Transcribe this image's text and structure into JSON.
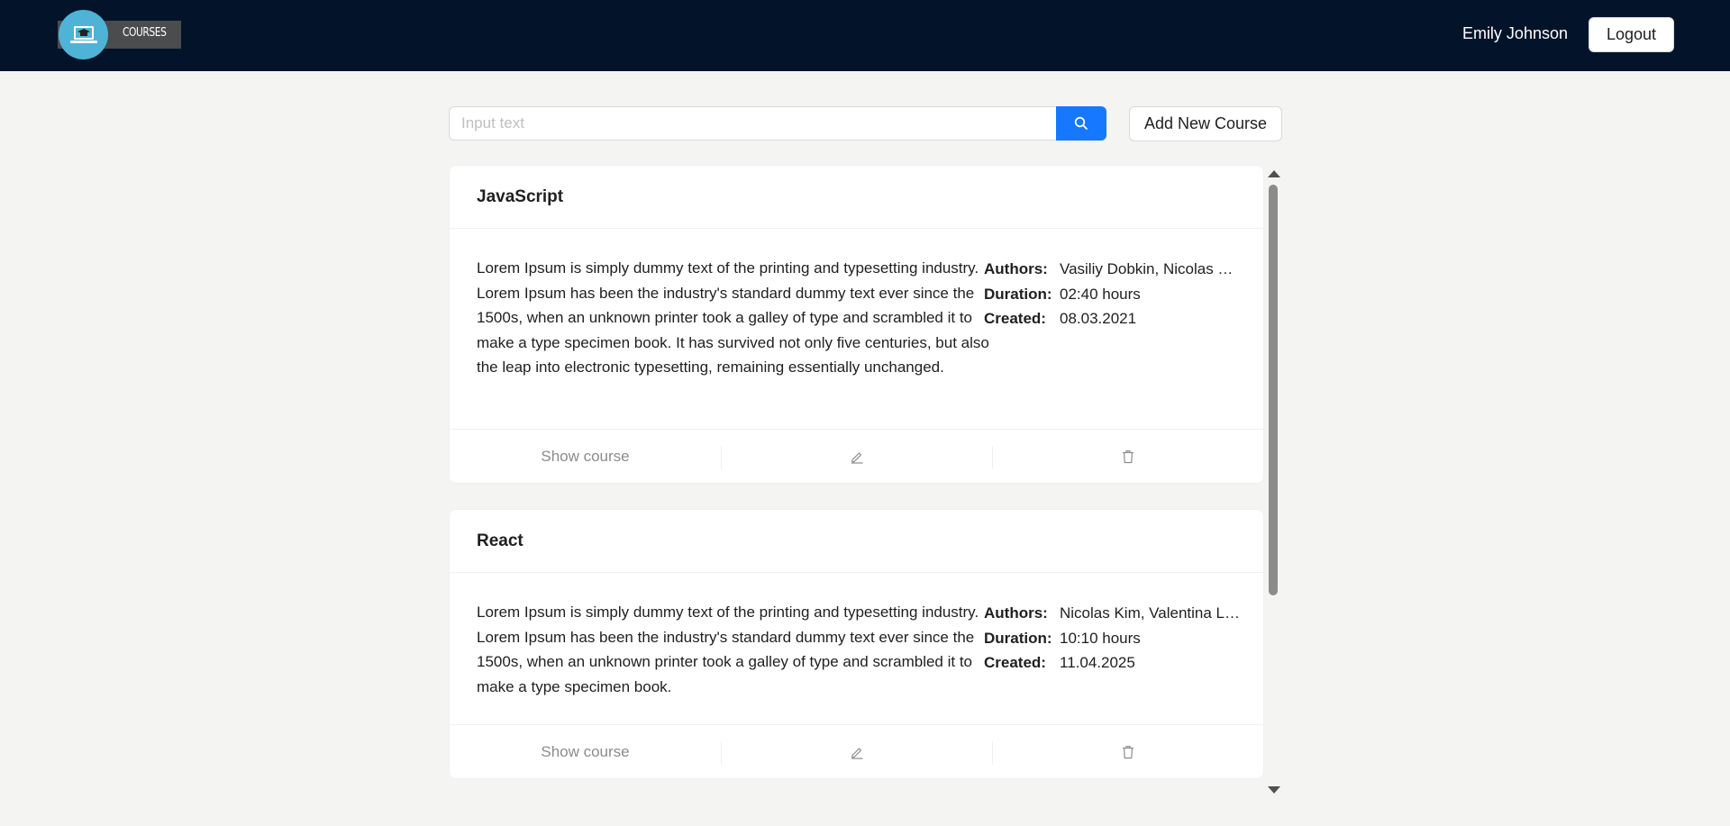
{
  "header": {
    "logo_text": "COURSES",
    "user_name": "Emily Johnson",
    "logout_label": "Logout"
  },
  "search": {
    "placeholder": "Input text",
    "value": "",
    "add_button_label": "Add New Course"
  },
  "labels": {
    "authors": "Authors:",
    "duration": "Duration:",
    "created": "Created:",
    "show_course": "Show course"
  },
  "courses": [
    {
      "title": "JavaScript",
      "description": "Lorem Ipsum is simply dummy text of the printing and typesetting industry. Lorem Ipsum has been the industry's standard dummy text ever since the 1500s, when an unknown printer took a galley of type and scrambled it to make a type specimen book. It has survived not only five centuries, but also the leap into electronic typesetting, remaining essentially unchanged.",
      "authors": "Vasiliy Dobkin, Nicolas Kim",
      "duration": "02:40 hours",
      "created": "08.03.2021"
    },
    {
      "title": "React",
      "description": "Lorem Ipsum is simply dummy text of the printing and typesetting industry. Lorem Ipsum has been the industry's standard dummy text ever since the 1500s, when an unknown printer took a galley of type and scrambled it to make a type specimen book.",
      "authors": "Nicolas Kim, Valentina Larina",
      "duration": "10:10 hours",
      "created": "11.04.2025"
    }
  ],
  "colors": {
    "header_bg": "#03142a",
    "primary": "#1677ff",
    "logo_circle": "#4fb3d8",
    "page_bg": "#f4f4f3"
  },
  "icons": {
    "search": "search-icon",
    "edit": "edit-icon",
    "delete": "delete-icon",
    "logo": "laptop-graduation-icon"
  }
}
